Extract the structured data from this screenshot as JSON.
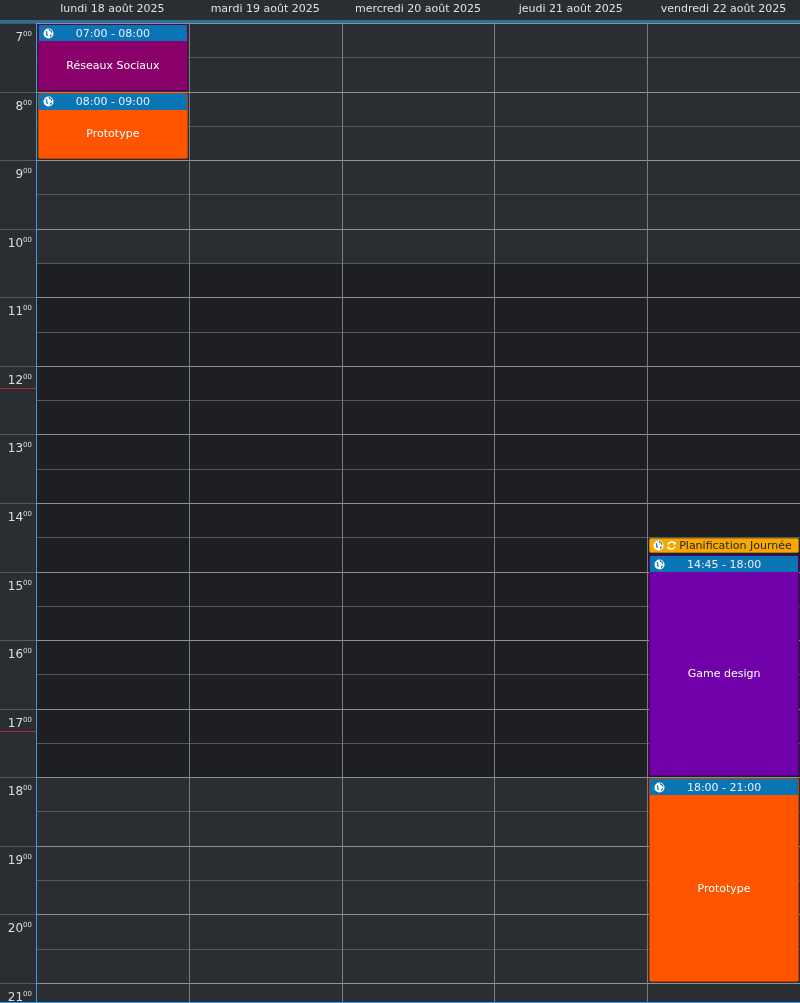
{
  "days": [
    {
      "label": "lundi 18 août 2025",
      "today": true,
      "events": [
        {
          "kind": "timed",
          "time": "07:00 - 08:00",
          "title": "Réseaux Sociaux",
          "color": "#8a006b"
        },
        {
          "kind": "timed",
          "time": "08:00 - 09:00",
          "title": "Prototype",
          "color": "#ff5500"
        }
      ]
    },
    {
      "label": "mardi 19 août 2025",
      "today": false
    },
    {
      "label": "mercredi 20 août 2025",
      "today": false
    },
    {
      "label": "jeudi 21 août 2025",
      "today": false
    },
    {
      "label": "vendredi 22 août 2025",
      "today": false,
      "events": [
        {
          "kind": "task",
          "title": "Planification Journée",
          "color": "#f7a800",
          "recurring": true
        },
        {
          "kind": "timed",
          "time": "14:45 - 18:00",
          "title": "Game design",
          "color": "#7000aa"
        },
        {
          "kind": "timed",
          "time": "18:00 - 21:00",
          "title": "Prototype",
          "color": "#ff5500"
        }
      ]
    }
  ],
  "hours": [
    {
      "label": "7$^{00}$",
      "marker": false,
      "slots": [
        {
          "working": false
        },
        {
          "working": false
        }
      ]
    },
    {
      "label": "8$^{00}$",
      "marker": false,
      "slots": [
        {
          "working": false
        },
        {
          "working": false
        }
      ]
    },
    {
      "label": "9$^{00}$",
      "marker": false,
      "slots": [
        {
          "working": false
        },
        {
          "working": false
        }
      ]
    },
    {
      "label": "10$^{00}$",
      "marker": false,
      "slots": [
        {
          "working": false
        },
        {
          "working": true
        }
      ]
    },
    {
      "label": "11$^{00}$",
      "marker": false,
      "slots": [
        {
          "working": true
        },
        {
          "working": true
        }
      ]
    },
    {
      "label": "12$^{00}$",
      "marker": true,
      "slots": [
        {
          "working": true
        },
        {
          "working": true
        }
      ]
    },
    {
      "label": "13$^{00}$",
      "marker": false,
      "slots": [
        {
          "working": true
        },
        {
          "working": true
        }
      ]
    },
    {
      "label": "14$^{00}$",
      "marker": false,
      "slots": [
        {
          "working": true
        },
        {
          "working": true
        }
      ]
    },
    {
      "label": "15$^{00}$",
      "marker": false,
      "slots": [
        {
          "working": true
        },
        {
          "working": true
        }
      ]
    },
    {
      "label": "16$^{00}$",
      "marker": false,
      "slots": [
        {
          "working": true
        },
        {
          "working": true
        }
      ]
    },
    {
      "label": "17$^{00}$",
      "marker": true,
      "slots": [
        {
          "working": true
        },
        {
          "working": true
        }
      ]
    },
    {
      "label": "18$^{00}$",
      "marker": false,
      "slots": [
        {
          "working": false
        },
        {
          "working": false
        }
      ]
    },
    {
      "label": "19$^{00}$",
      "marker": false,
      "slots": [
        {
          "working": false
        },
        {
          "working": false
        }
      ]
    },
    {
      "label": "20$^{00}$",
      "marker": false,
      "slots": [
        {
          "working": false
        },
        {
          "working": false
        }
      ]
    },
    {
      "label": "21$^{00}$",
      "marker": false,
      "slots": [
        {
          "working": false
        }
      ]
    }
  ]
}
